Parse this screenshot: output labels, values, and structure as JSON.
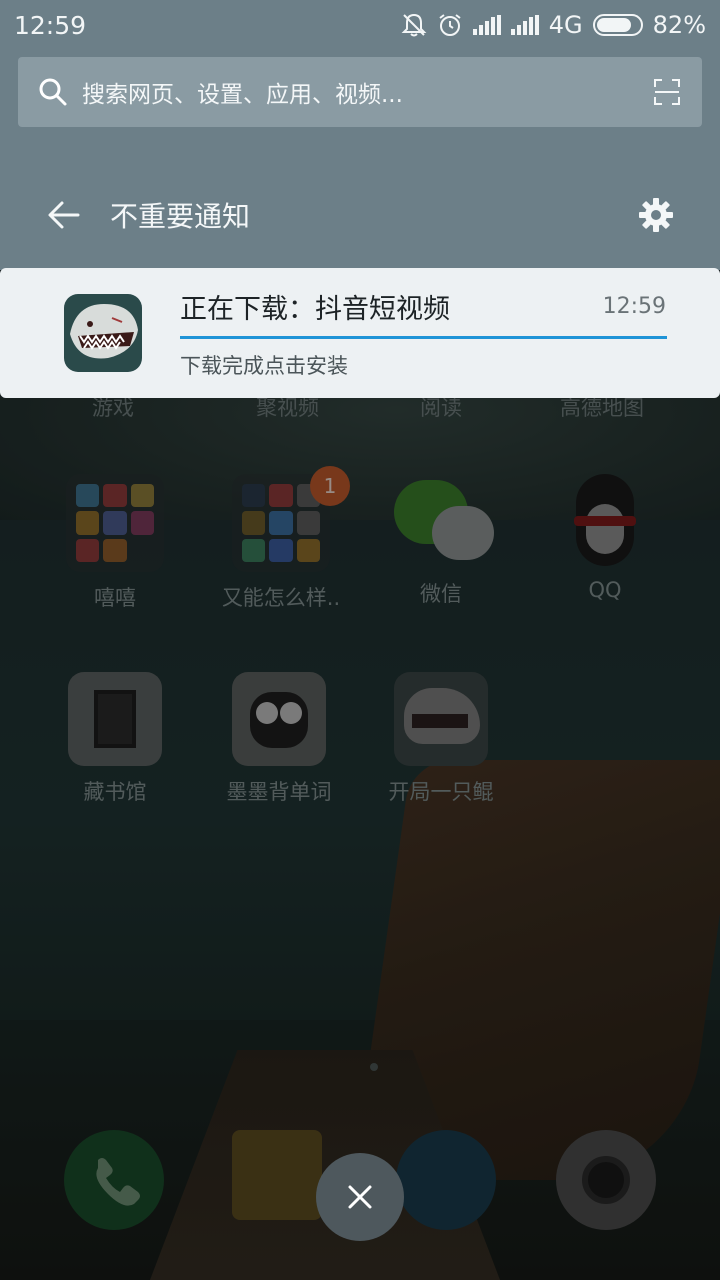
{
  "status_bar": {
    "time": "12:59",
    "network": "4G",
    "battery": "82%",
    "battery_level": 0.82
  },
  "search": {
    "placeholder": "搜索网页、设置、应用、视频..."
  },
  "section": {
    "title": "不重要通知"
  },
  "notification": {
    "title": "正在下载：抖音短视频",
    "time": "12:59",
    "subtitle": "下载完成点击安装",
    "progress": 1.0,
    "icon": "shark-app-icon"
  },
  "home_screen": {
    "partial_row": [
      "游戏",
      "聚视频",
      "阅读",
      "高德地图"
    ],
    "row1": [
      {
        "label": "嘻嘻",
        "type": "folder"
      },
      {
        "label": "又能怎么样..",
        "type": "folder",
        "badge": "1"
      },
      {
        "label": "微信",
        "type": "app"
      },
      {
        "label": "QQ",
        "type": "app"
      }
    ],
    "row2": [
      {
        "label": "藏书馆"
      },
      {
        "label": "墨墨背单词"
      },
      {
        "label": "开局一只鲲"
      }
    ]
  },
  "colors": {
    "panel": "#6c7f88",
    "card": "#edf1f3",
    "progress": "#1f94d7"
  }
}
